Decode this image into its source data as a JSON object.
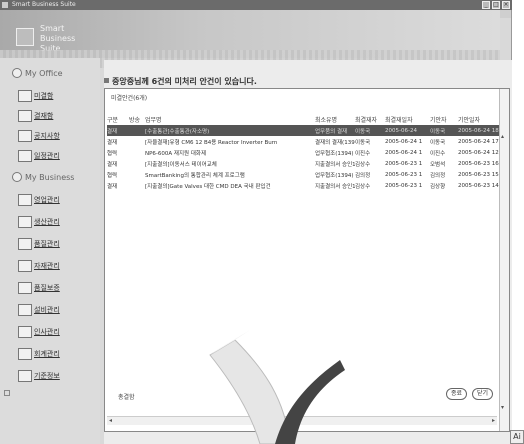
{
  "window": {
    "title": "Smart Business Suite",
    "min_glyph": "_",
    "max_glyph": "□",
    "close_glyph": "×"
  },
  "header": {
    "logo_line1": "Smart",
    "logo_line2": "Business",
    "logo_line3": "Suite"
  },
  "sidebar": {
    "section_office": "My Office",
    "section_business": "My Business",
    "office_items": [
      "미결함",
      "결재함",
      "공지사항",
      "일정관리"
    ],
    "business_items": [
      "영업관리",
      "생산관리",
      "품질관리",
      "자재관리",
      "품질보증",
      "설비관리",
      "인사관리",
      "회계관리",
      "기준정보"
    ]
  },
  "main": {
    "notice": "중앙중님께 6건의 미처리 안건이 있습니다.",
    "tab_label": "미결안건(6개)",
    "columns": [
      "구분",
      "방송",
      "업무명",
      "최소유명",
      "최결재자",
      "최결재일자",
      "기안자",
      "기안일자"
    ],
    "rows": [
      [
        "결재",
        "",
        "[수출통관]수출통관(자소명)",
        "업무품의 결재",
        "이동국",
        "2005-06-24",
        "이동국",
        "2005-06-24 18"
      ],
      [
        "결재",
        "",
        "[자율결재]유형 CM6 12 B4용 Reactor Inverter Burn",
        "결재의 결재(1394)",
        "이동국",
        "2005-06-24 1",
        "이동국",
        "2005-06-24 17"
      ],
      [
        "협력",
        "",
        "NP6-600A 재지원 대화제",
        "업무협조(1394)",
        "이진수",
        "2005-06-24 1",
        "이진수",
        "2005-06-24 12"
      ],
      [
        "결재",
        "",
        "[지출결의]이동서스 테이어교체",
        "지출결의서 승인1",
        "김상수",
        "2005-06-23 1",
        "오범석",
        "2005-06-23 16"
      ],
      [
        "협력",
        "",
        "SmartBanking의 통합관리 체계 프로그램",
        "업무협조(1394)",
        "김의정",
        "2005-06-23 1",
        "김의정",
        "2005-06-23 15"
      ],
      [
        "결재",
        "",
        "[지출결의]Gate Valves 대한 CMD DEA 국내 판입건",
        "지출결의서 승인1",
        "김상수",
        "2005-06-23 1",
        "김상향",
        "2005-06-23 14"
      ]
    ],
    "footer_label": "총결함",
    "btn_ok": "종료",
    "btn_close": "닫기",
    "scroll_left": "◂",
    "scroll_right": "▸",
    "scroll_up": "▴",
    "scroll_down": "▾"
  },
  "corner_text": "Ai"
}
